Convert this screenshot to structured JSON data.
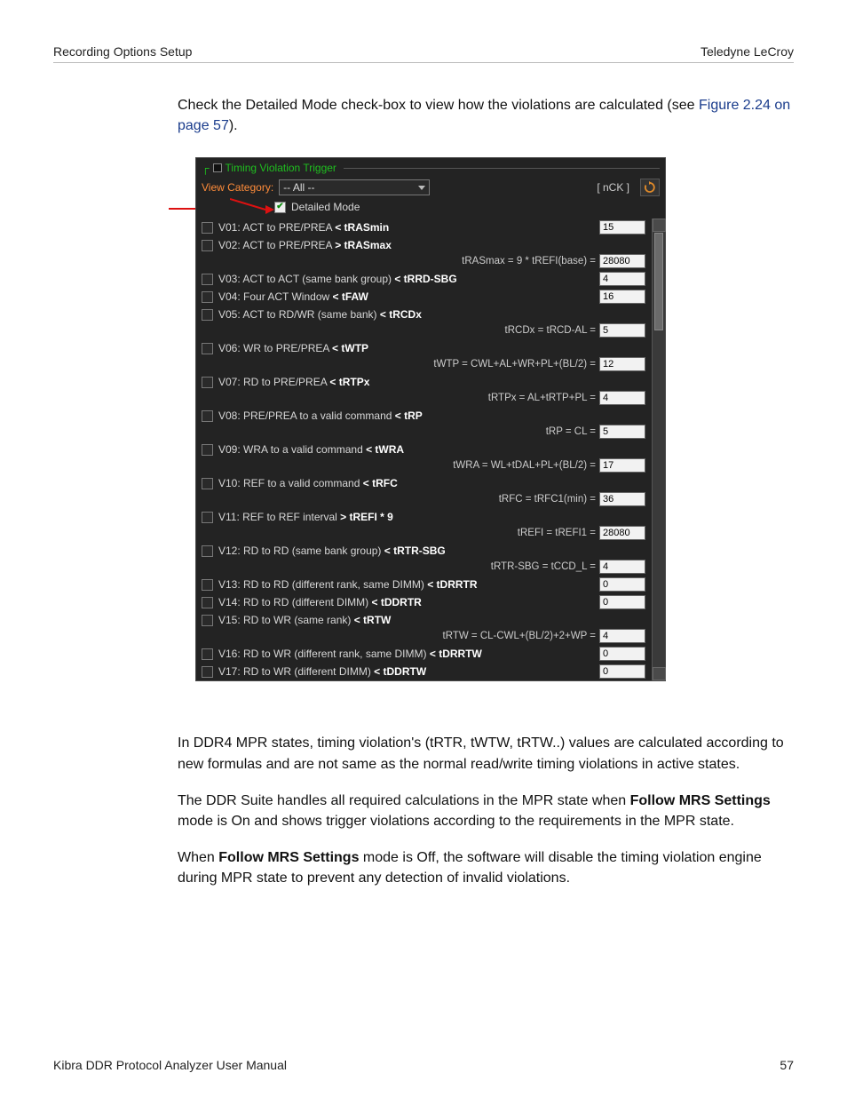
{
  "header": {
    "left": "Recording Options Setup",
    "right": "Teledyne LeCroy"
  },
  "intro": {
    "text1": "Check the Detailed Mode check-box to view how the violations are calculated (see ",
    "link": "Figure 2.24 on page 57",
    "text2": ")."
  },
  "panel": {
    "legend": "Timing Violation Trigger",
    "view_category_label": "View Category:",
    "view_category_value": "-- All --",
    "nck_label": "[ nCK ]",
    "detailed_mode_label": "Detailed Mode",
    "refresh_icon": "refresh",
    "items": [
      {
        "id": "V01",
        "pre": "V01: ACT to PRE/PREA ",
        "op": "<",
        "bold": " tRASmin",
        "value": "15"
      },
      {
        "id": "V02",
        "pre": "V02: ACT to PRE/PREA ",
        "op": ">",
        "bold": " tRASmax",
        "calc": "tRASmax = 9 * tREFI(base) =",
        "value": "28080"
      },
      {
        "id": "V03",
        "pre": "V03: ACT to ACT (same bank group) ",
        "op": "<",
        "bold": " tRRD-SBG",
        "value": "4"
      },
      {
        "id": "V04",
        "pre": "V04: Four ACT Window ",
        "op": "<",
        "bold": " tFAW",
        "value": "16"
      },
      {
        "id": "V05",
        "pre": "V05: ACT to RD/WR (same bank) ",
        "op": "<",
        "bold": " tRCDx",
        "calc": "tRCDx = tRCD-AL =",
        "value": "5"
      },
      {
        "id": "V06",
        "pre": "V06: WR to PRE/PREA ",
        "op": "<",
        "bold": " tWTP",
        "calc": "tWTP = CWL+AL+WR+PL+(BL/2) =",
        "value": "12"
      },
      {
        "id": "V07",
        "pre": "V07: RD to PRE/PREA ",
        "op": "<",
        "bold": " tRTPx",
        "calc": "tRTPx = AL+tRTP+PL =",
        "value": "4"
      },
      {
        "id": "V08",
        "pre": "V08: PRE/PREA to a valid command ",
        "op": "<",
        "bold": " tRP",
        "calc": "tRP = CL =",
        "value": "5"
      },
      {
        "id": "V09",
        "pre": "V09: WRA to a valid command ",
        "op": "<",
        "bold": " tWRA",
        "calc": "tWRA = WL+tDAL+PL+(BL/2) =",
        "value": "17"
      },
      {
        "id": "V10",
        "pre": "V10: REF to a valid command ",
        "op": "<",
        "bold": " tRFC",
        "calc": "tRFC = tRFC1(min) =",
        "value": "36"
      },
      {
        "id": "V11",
        "pre": "V11: REF to REF interval ",
        "op": ">",
        "bold": " tREFI * 9",
        "calc": "tREFI = tREFI1 =",
        "value": "28080"
      },
      {
        "id": "V12",
        "pre": "V12: RD to RD (same bank group) ",
        "op": "<",
        "bold": " tRTR-SBG",
        "calc": "tRTR-SBG = tCCD_L =",
        "value": "4"
      },
      {
        "id": "V13",
        "pre": "V13: RD to RD (different rank, same DIMM) ",
        "op": "<",
        "bold": " tDRRTR",
        "value": "0"
      },
      {
        "id": "V14",
        "pre": "V14: RD to RD (different DIMM) ",
        "op": "<",
        "bold": " tDDRTR",
        "value": "0"
      },
      {
        "id": "V15",
        "pre": "V15: RD to WR (same rank) ",
        "op": "<",
        "bold": " tRTW",
        "calc": "tRTW = CL-CWL+(BL/2)+2+WP =",
        "value": "4"
      },
      {
        "id": "V16",
        "pre": "V16: RD to WR (different rank, same DIMM) ",
        "op": "<",
        "bold": " tDRRTW",
        "value": "0"
      },
      {
        "id": "V17",
        "pre": "V17: RD to WR (different DIMM) ",
        "op": "<",
        "bold": " tDDRTW",
        "value": "0"
      }
    ]
  },
  "body": {
    "p1": "In DDR4 MPR states, timing violation's (tRTR, tWTW, tRTW..) values are calculated according to new formulas and are not same as the normal read/write timing violations in active states.",
    "p2a": "The DDR Suite handles all required calculations in the MPR state when ",
    "p2b": "Follow MRS Settings",
    "p2c": " mode is On and shows trigger violations according to the requirements in the MPR state.",
    "p3a": "When ",
    "p3b": "Follow MRS Settings",
    "p3c": " mode is Off, the software will disable the timing violation engine during MPR state to prevent any detection of invalid violations."
  },
  "footer": {
    "left": "Kibra DDR Protocol Analyzer User Manual",
    "right": "57"
  }
}
